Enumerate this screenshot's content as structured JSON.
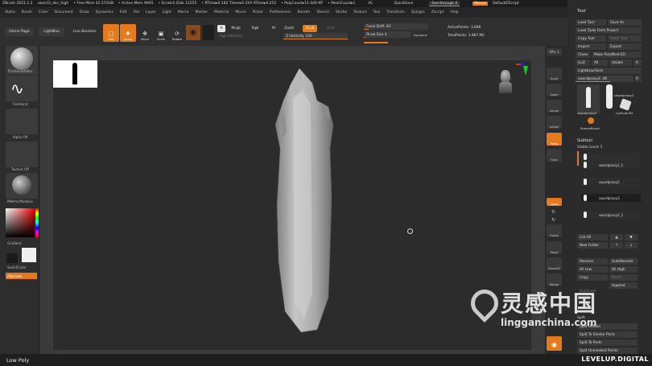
{
  "titlebar": {
    "items": [
      "ZBrush 2021.1.2",
      "sword3_dec_high",
      "• Free Mem 42.573GB",
      "• Active Mem 9945",
      "• Scratch Disk 12255",
      "• RTime▸0.182 Timer▸0.319 ATime▸0.252",
      "• PolyCount▸11.449 KP",
      "• MeshCount▸1",
      "AC",
      "QuickSave",
      "See-through 0",
      "Menus",
      "DefaultZScript"
    ]
  },
  "menubar": {
    "items": [
      "Alpha",
      "Brush",
      "Color",
      "Document",
      "Draw",
      "Dynamics",
      "Edit",
      "File",
      "Layer",
      "Light",
      "Macro",
      "Marker",
      "Material",
      "Movie",
      "Picker",
      "Preferences",
      "Render",
      "Stencil",
      "Stroke",
      "Texture",
      "Tool",
      "Transform",
      "Zplugin",
      "Zscript",
      "Help"
    ]
  },
  "toolbar": {
    "home_page": "Home Page",
    "lightbox": "LightBox",
    "live_boolean": "Live Boolean",
    "edit": "Edit",
    "draw": "Draw",
    "move": "Move",
    "scale": "Scale",
    "rotate": "Rotate",
    "a": "A",
    "mrgb": "Mrgb",
    "rgb": "Rgb",
    "m": "M",
    "zadd": "Zadd",
    "zsub": "Zsub",
    "zcut": "Zcut",
    "rgb_intensity": "Rgb Intensity",
    "z_intensity": "Z Intensity 100",
    "focal_shift": "Focal Shift -83",
    "draw_size": "Draw Size 4",
    "dynamic": "Dynamic",
    "active_points": "ActivePoints: 3,686",
    "total_points": "TotalPoints: 3.887 Mil"
  },
  "leftshelf": {
    "brush": "TrimSmoothBor",
    "stroke": "FreeHand",
    "alpha": "Alpha Off",
    "texture": "Texture Off",
    "material": "MAHmcModelas",
    "gradient": "Gradient",
    "switch_color": "SwitchColor",
    "alternate": "Alternate"
  },
  "rightshelf": {
    "spix": "SPix 3",
    "items": [
      "Scroll",
      "Zoom",
      "Actual",
      "AAHalf",
      "Persp",
      "Floor",
      "Local",
      "Frame",
      "Move",
      "Zoom3D",
      "Rotate"
    ]
  },
  "tool": {
    "header": "Tool",
    "load_tool": "Load Tool",
    "save_as": "Save As",
    "load_from_project": "Load Tools From Project",
    "copy_tool": "Copy Tool",
    "paste_tool": "Paste Tool",
    "import": "Import",
    "export": "Export",
    "clone": "Clone",
    "make_polymesh": "Make PolyMesh3D",
    "goz": "GoZ",
    "all": "All",
    "visible": "Visible",
    "r": "R",
    "lightbox_tools": "Lightbox▸Tools",
    "current_tool": "swordproxy3: 48",
    "r2": "R",
    "thumb1": "swordproxy3",
    "thumb2": "swordproxy3",
    "thumb3": "Cylinder3D",
    "thumb4": "SimpleBrush",
    "subtool_header": "Subtool",
    "visible_count": "Visible Count: 5",
    "subtools": [
      "swordproxy1_1",
      "swordproxy2",
      "swordproxy3",
      "swordproxy2_1"
    ],
    "list_all": "List All",
    "new_folder": "New Folder",
    "rename": "Rename",
    "autoreorder": "AutoReorder",
    "all_low": "All Low",
    "all_high": "All High",
    "copy": "Copy",
    "paste": "Paste",
    "append": "Append",
    "duplicate": "Duplicate",
    "split_header": "Split",
    "split_hidden": "Split Hidden",
    "split_similar": "Split To Similar Parts",
    "split_parts": "Split To Parts",
    "split_unmasked": "Split Unmasked Points"
  },
  "status": {
    "left": "Low Poly"
  },
  "watermark": {
    "cn": "灵感中国",
    "url": "lingganchina.com",
    "levelup": "LEVELUP.DIGITAL"
  },
  "colors": {
    "accent": "#e47a1d",
    "bg": "#2a2a2a",
    "viewport": "#2c2c2c",
    "model": "#a9a9a9"
  }
}
